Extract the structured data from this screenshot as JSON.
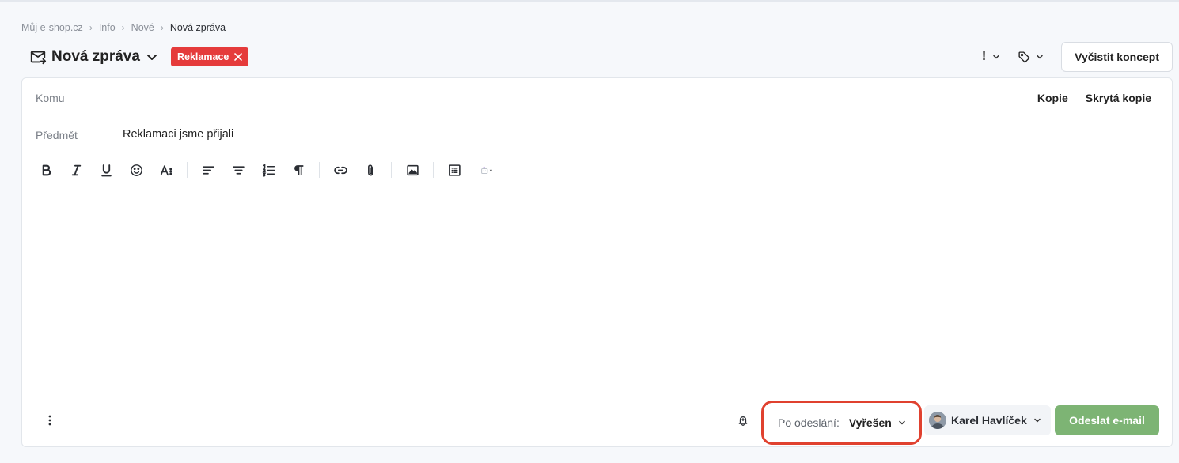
{
  "breadcrumb": [
    "Můj e-shop.cz",
    "Info",
    "Nové",
    "Nová zpráva"
  ],
  "header": {
    "title": "Nová zpráva",
    "tag_label": "Reklamace",
    "priority_symbol": "!",
    "clear_draft_label": "Vyčistit koncept"
  },
  "compose": {
    "to_label": "Komu",
    "to_value": "",
    "cc_label": "Kopie",
    "bcc_label": "Skrytá kopie",
    "subject_label": "Předmět",
    "subject_value": "Reklamaci jsme přijali",
    "body_value": ""
  },
  "toolbar": {
    "items": [
      "bold",
      "italic",
      "underline",
      "emoji",
      "font-size",
      "align-left",
      "align-center",
      "ordered-list",
      "paragraph",
      "link",
      "attachment",
      "image",
      "template",
      "ai-assistant"
    ]
  },
  "footer": {
    "after_send_label": "Po odeslání:",
    "after_send_value": "Vyřešen",
    "assignee_name": "Karel Havlíček",
    "send_label": "Odeslat e-mail"
  },
  "colors": {
    "tag": "#e53b3b",
    "send_button": "#7db474",
    "highlight_outline": "#e0412f"
  }
}
